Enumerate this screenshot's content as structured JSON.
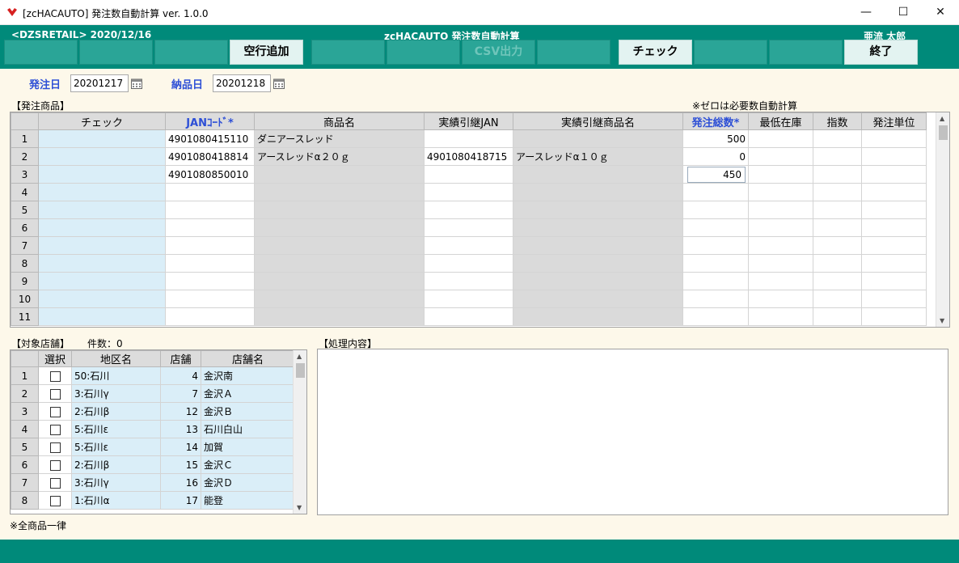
{
  "window": {
    "title": "[zcHACAUTO] 発注数自動計算 ver. 1.0.0",
    "minimize": "—",
    "maximize": "☐",
    "close": "✕"
  },
  "header": {
    "left": "<DZSRETAIL>  2020/12/16",
    "center": "zcHACAUTO  発注数自動計算",
    "right": "亜流  太郎"
  },
  "fkeys": [
    "",
    "",
    "空行追加",
    "",
    "",
    "CSV出力",
    "",
    "チェック",
    "",
    "",
    "終了"
  ],
  "dates": {
    "order_label": "発注日",
    "order_value": "20201217",
    "delivery_label": "納品日",
    "delivery_value": "20201218"
  },
  "products": {
    "section_label": "【発注商品】",
    "note": "※ゼロは必要数自動計算",
    "columns": [
      "チェック",
      "JANｺｰﾄﾞ*",
      "商品名",
      "実績引継JAN",
      "実績引継商品名",
      "発注総数*",
      "最低在庫",
      "指数",
      "発注単位"
    ],
    "rows": [
      {
        "n": "1",
        "check": "",
        "jan": "4901080415110",
        "name": "ダニアースレッド",
        "src_jan": "",
        "src_name": "",
        "qty": "500",
        "min": "",
        "idx": "",
        "unit": ""
      },
      {
        "n": "2",
        "check": "",
        "jan": "4901080418814",
        "name": "アースレッドα２０ｇ",
        "src_jan": "4901080418715",
        "src_name": "アースレッドα１０ｇ",
        "qty": "0",
        "min": "",
        "idx": "",
        "unit": ""
      },
      {
        "n": "3",
        "check": "",
        "jan": "4901080850010",
        "name": "",
        "src_jan": "",
        "src_name": "",
        "qty": "450",
        "min": "",
        "idx": "",
        "unit": ""
      },
      {
        "n": "4",
        "check": "",
        "jan": "",
        "name": "",
        "src_jan": "",
        "src_name": "",
        "qty": "",
        "min": "",
        "idx": "",
        "unit": ""
      },
      {
        "n": "5",
        "check": "",
        "jan": "",
        "name": "",
        "src_jan": "",
        "src_name": "",
        "qty": "",
        "min": "",
        "idx": "",
        "unit": ""
      },
      {
        "n": "6",
        "check": "",
        "jan": "",
        "name": "",
        "src_jan": "",
        "src_name": "",
        "qty": "",
        "min": "",
        "idx": "",
        "unit": ""
      },
      {
        "n": "7",
        "check": "",
        "jan": "",
        "name": "",
        "src_jan": "",
        "src_name": "",
        "qty": "",
        "min": "",
        "idx": "",
        "unit": ""
      },
      {
        "n": "8",
        "check": "",
        "jan": "",
        "name": "",
        "src_jan": "",
        "src_name": "",
        "qty": "",
        "min": "",
        "idx": "",
        "unit": ""
      },
      {
        "n": "9",
        "check": "",
        "jan": "",
        "name": "",
        "src_jan": "",
        "src_name": "",
        "qty": "",
        "min": "",
        "idx": "",
        "unit": ""
      },
      {
        "n": "10",
        "check": "",
        "jan": "",
        "name": "",
        "src_jan": "",
        "src_name": "",
        "qty": "",
        "min": "",
        "idx": "",
        "unit": ""
      },
      {
        "n": "11",
        "check": "",
        "jan": "",
        "name": "",
        "src_jan": "",
        "src_name": "",
        "qty": "",
        "min": "",
        "idx": "",
        "unit": ""
      }
    ]
  },
  "stores": {
    "section_label": "【対象店舗】",
    "count_label": "件数：0",
    "columns": [
      "選択",
      "地区名",
      "店舗",
      "店舗名"
    ],
    "rows": [
      {
        "n": "1",
        "area": "50:石川",
        "store": "4",
        "name": "金沢南"
      },
      {
        "n": "2",
        "area": "3:石川γ",
        "store": "7",
        "name": "金沢Ａ"
      },
      {
        "n": "3",
        "area": "2:石川β",
        "store": "12",
        "name": "金沢Ｂ"
      },
      {
        "n": "4",
        "area": "5:石川ε",
        "store": "13",
        "name": "石川白山"
      },
      {
        "n": "5",
        "area": "5:石川ε",
        "store": "14",
        "name": "加賀"
      },
      {
        "n": "6",
        "area": "2:石川β",
        "store": "15",
        "name": "金沢Ｃ"
      },
      {
        "n": "7",
        "area": "3:石川γ",
        "store": "16",
        "name": "金沢Ｄ"
      },
      {
        "n": "8",
        "area": "1:石川α",
        "store": "17",
        "name": "能登"
      }
    ],
    "footnote": "※全商品一律"
  },
  "process": {
    "section_label": "【処理内容】"
  },
  "colors": {
    "header_teal": "#008a7a",
    "accent_blue": "#2d4fd6",
    "check_col": "#daeef8"
  }
}
